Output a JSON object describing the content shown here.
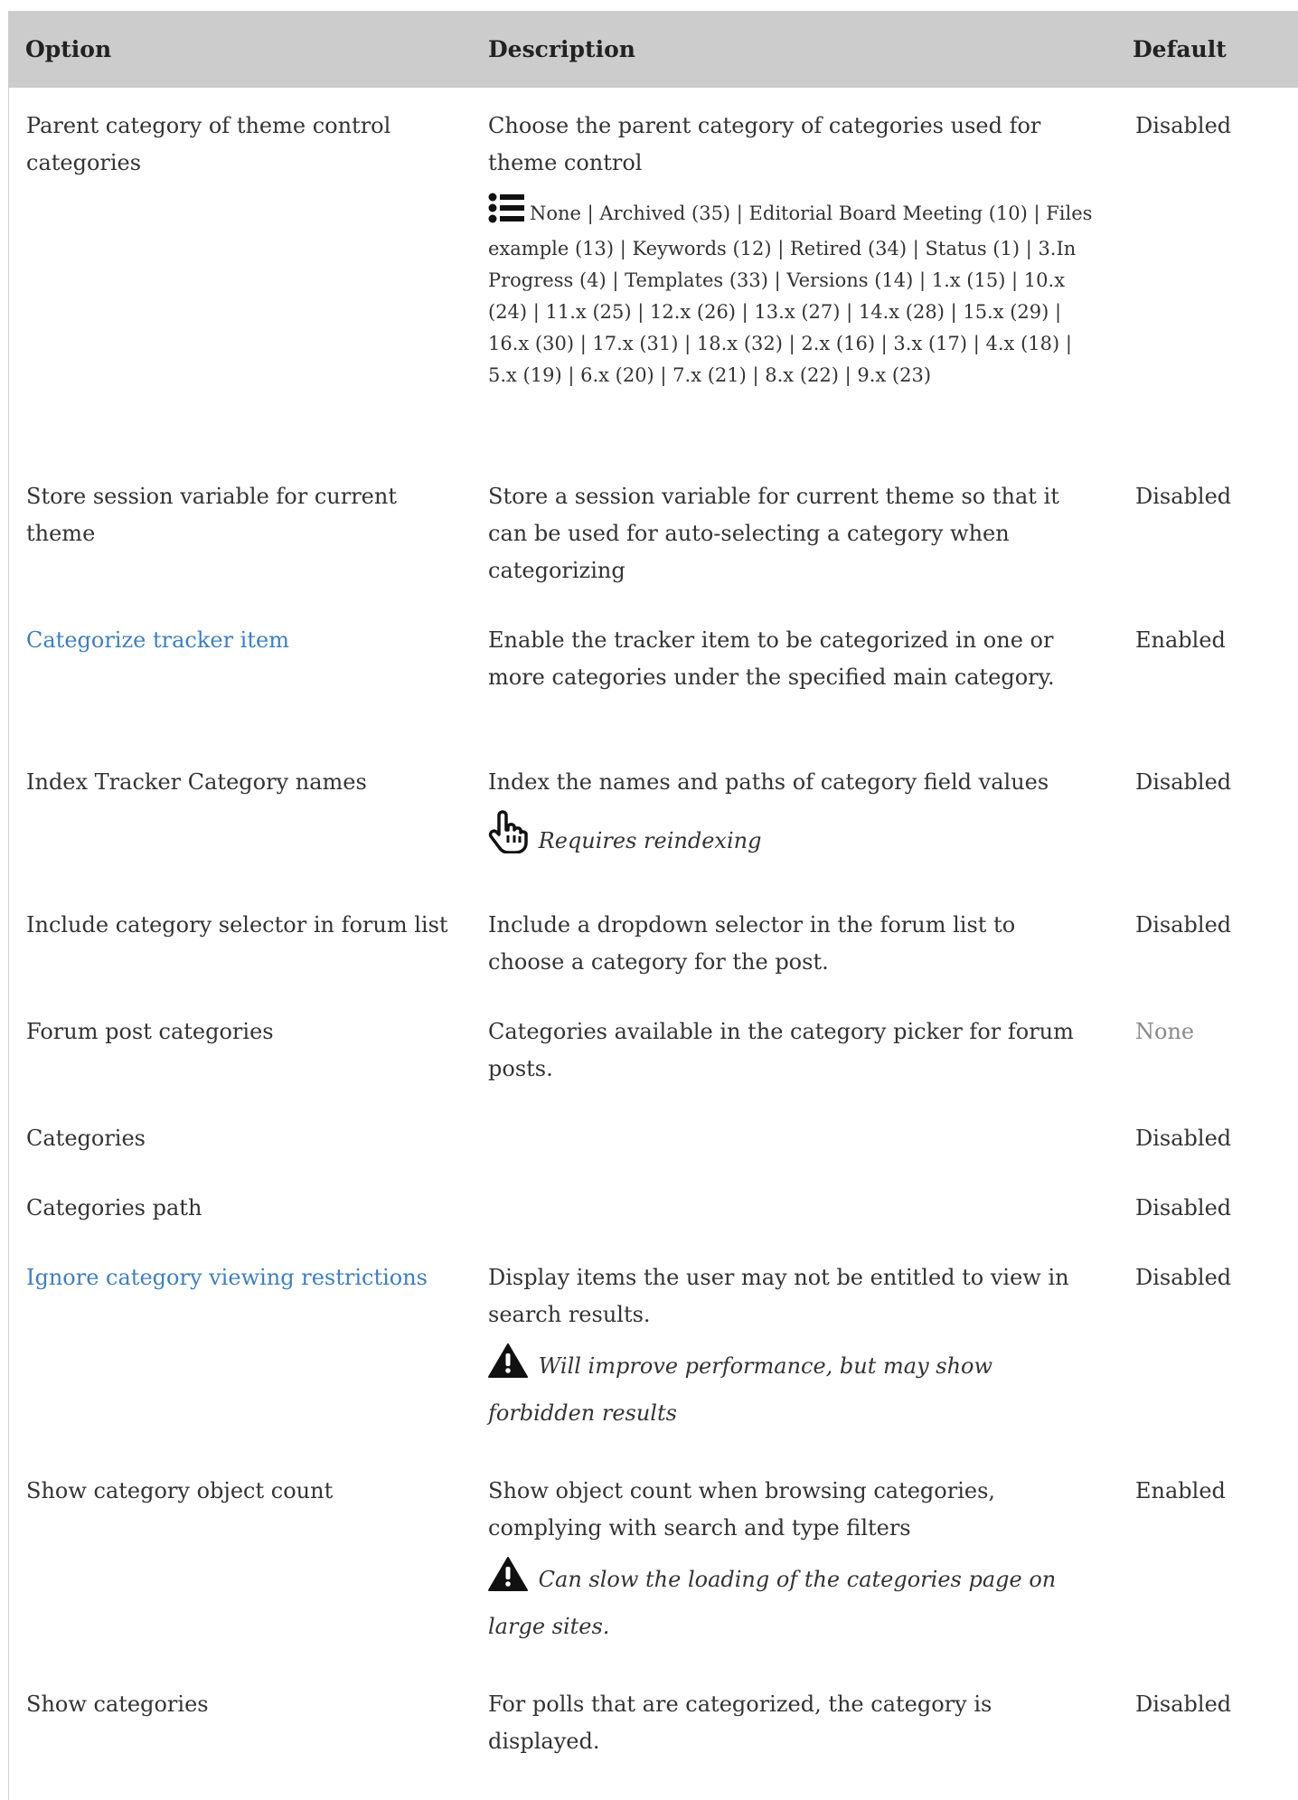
{
  "headers": {
    "option": "Option",
    "description": "Description",
    "default": "Default"
  },
  "rows": [
    {
      "option": "Parent category of theme control categories",
      "description": "Choose the parent category of categories used for theme control",
      "categories_text": "None | Archived (35) | Editorial Board Meeting (10) | Files example (13) | Keywords (12) | Retired (34) | Status (1) | 3.In Progress (4) | Templates (33) | Versions (14) | 1.x (15) | 10.x (24) | 11.x (25) | 12.x (26) | 13.x (27) | 14.x (28) | 15.x (29) | 16.x (30) | 17.x (31) | 18.x (32) | 2.x (16) | 3.x (17) | 4.x (18) | 5.x (19) | 6.x (20) | 7.x (21) | 8.x (22) | 9.x (23)",
      "default": "Disabled"
    },
    {
      "option": "Store session variable for current theme",
      "description": "Store a session variable for current theme so that it can be used for auto-selecting a category when categorizing",
      "default": "Disabled"
    },
    {
      "option": "Categorize tracker item",
      "description": "Enable the tracker item to be categorized in one or more categories under the specified main category.",
      "default": "Enabled"
    },
    {
      "option": "Index Tracker Category names",
      "description": "Index the names and paths of category field values",
      "note": "Requires reindexing",
      "default": "Disabled"
    },
    {
      "option": "Include category selector in forum list",
      "description": "Include a dropdown selector in the forum list to choose a category for the post.",
      "default": "Disabled"
    },
    {
      "option": "Forum post categories",
      "description": "Categories available in the category picker for forum posts.",
      "default": "None"
    },
    {
      "option": "Categories",
      "description": "",
      "default": "Disabled"
    },
    {
      "option": "Categories path",
      "description": "",
      "default": "Disabled"
    },
    {
      "option": "Ignore category viewing restrictions",
      "description": "Display items the user may not be entitled to view in search results.",
      "note": "Will improve performance, but may show forbidden results",
      "default": "Disabled"
    },
    {
      "option": "Show category object count",
      "description": "Show object count when browsing categories, complying with search and type filters",
      "note": "Can slow the loading of the categories page on large sites.",
      "default": "Enabled"
    },
    {
      "option": "Show categories",
      "description": "For polls that are categorized, the category is displayed.",
      "default": "Disabled"
    }
  ],
  "icons": {
    "list": "list-icon",
    "hand": "hand-pointer-icon",
    "warning": "warning-icon"
  },
  "colors": {
    "header_bg": "#cccccc",
    "link": "#3f7fbf",
    "muted": "#8a8a8a"
  }
}
